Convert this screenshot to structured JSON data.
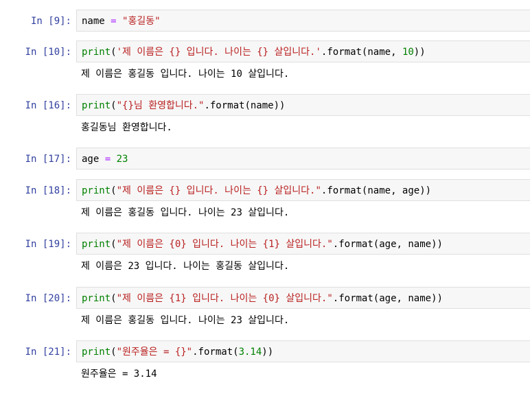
{
  "cells": [
    {
      "prompt": "In [9]:",
      "code": [
        {
          "t": "name",
          "c": "name"
        },
        {
          "t": " ",
          "c": "name"
        },
        {
          "t": "=",
          "c": "op"
        },
        {
          "t": " ",
          "c": "name"
        },
        {
          "t": "\"홍길동\"",
          "c": "str"
        }
      ],
      "output": null
    },
    {
      "prompt": "In [10]:",
      "code": [
        {
          "t": "print",
          "c": "kw"
        },
        {
          "t": "(",
          "c": "name"
        },
        {
          "t": "'제 이름은 {} 입니다. 나이는 {} 살입니다.'",
          "c": "str"
        },
        {
          "t": ".format(name, ",
          "c": "name"
        },
        {
          "t": "10",
          "c": "num"
        },
        {
          "t": "))",
          "c": "name"
        }
      ],
      "output": "제 이름은 홍길동 입니다. 나이는 10 살입니다."
    },
    {
      "prompt": "In [16]:",
      "code": [
        {
          "t": "print",
          "c": "kw"
        },
        {
          "t": "(",
          "c": "name"
        },
        {
          "t": "\"{}님 환영합니다.\"",
          "c": "str"
        },
        {
          "t": ".format(name))",
          "c": "name"
        }
      ],
      "output": "홍길동님 환영합니다."
    },
    {
      "prompt": "In [17]:",
      "code": [
        {
          "t": "age",
          "c": "name"
        },
        {
          "t": " ",
          "c": "name"
        },
        {
          "t": "=",
          "c": "op"
        },
        {
          "t": " ",
          "c": "name"
        },
        {
          "t": "23",
          "c": "num"
        }
      ],
      "output": null
    },
    {
      "prompt": "In [18]:",
      "code": [
        {
          "t": "print",
          "c": "kw"
        },
        {
          "t": "(",
          "c": "name"
        },
        {
          "t": "\"제 이름은 {} 입니다. 나이는 {} 살입니다.\"",
          "c": "str"
        },
        {
          "t": ".format(name, age))",
          "c": "name"
        }
      ],
      "output": "제 이름은 홍길동 입니다. 나이는 23 살입니다."
    },
    {
      "prompt": "In [19]:",
      "code": [
        {
          "t": "print",
          "c": "kw"
        },
        {
          "t": "(",
          "c": "name"
        },
        {
          "t": "\"제 이름은 {0} 입니다. 나이는 {1} 살입니다.\"",
          "c": "str"
        },
        {
          "t": ".format(age, name))",
          "c": "name"
        }
      ],
      "output": "제 이름은 23 입니다. 나이는 홍길동 살입니다."
    },
    {
      "prompt": "In [20]:",
      "code": [
        {
          "t": "print",
          "c": "kw"
        },
        {
          "t": "(",
          "c": "name"
        },
        {
          "t": "\"제 이름은 {1} 입니다. 나이는 {0} 살입니다.\"",
          "c": "str"
        },
        {
          "t": ".format(age, name))",
          "c": "name"
        }
      ],
      "output": "제 이름은 홍길동 입니다. 나이는 23 살입니다."
    },
    {
      "prompt": "In [21]:",
      "code": [
        {
          "t": "print",
          "c": "kw"
        },
        {
          "t": "(",
          "c": "name"
        },
        {
          "t": "\"원주율은 = {}\"",
          "c": "str"
        },
        {
          "t": ".format(",
          "c": "name"
        },
        {
          "t": "3.14",
          "c": "num"
        },
        {
          "t": "))",
          "c": "name"
        }
      ],
      "output": "원주율은 = 3.14"
    }
  ],
  "colors": {
    "prompt": "#303f9f",
    "keyword": "#008000",
    "string": "#ba2121",
    "operator": "#aa22ff",
    "number": "#008000",
    "input_bg": "#f7f7f7",
    "input_border": "#dfdfdf"
  }
}
